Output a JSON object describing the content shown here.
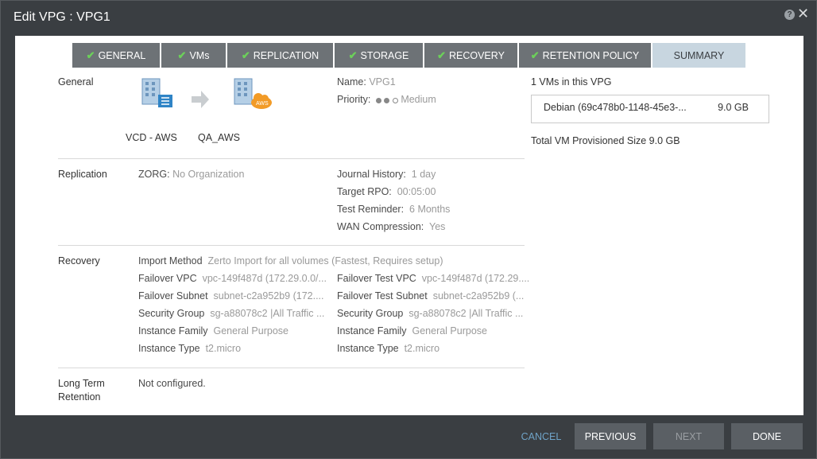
{
  "title": "Edit VPG : VPG1",
  "tabs": [
    {
      "label": "GENERAL",
      "checked": true
    },
    {
      "label": "VMs",
      "checked": true
    },
    {
      "label": "REPLICATION",
      "checked": true
    },
    {
      "label": "STORAGE",
      "checked": true
    },
    {
      "label": "RECOVERY",
      "checked": true
    },
    {
      "label": "RETENTION POLICY",
      "checked": true
    },
    {
      "label": "SUMMARY",
      "checked": false
    }
  ],
  "general": {
    "section_label": "General",
    "source_site": "VCD - AWS",
    "target_site": "QA_AWS",
    "cloud_badge": "AWS",
    "name_key": "Name:",
    "name_value": "VPG1",
    "priority_key": "Priority:",
    "priority_value": "Medium"
  },
  "replication": {
    "section_label": "Replication",
    "zorg_key": "ZORG:",
    "zorg_value": "No Organization",
    "journal_key": "Journal History:",
    "journal_value": "1 day",
    "rpo_key": "Target RPO:",
    "rpo_value": "00:05:00",
    "reminder_key": "Test Reminder:",
    "reminder_value": "6 Months",
    "wan_key": "WAN Compression:",
    "wan_value": "Yes"
  },
  "recovery": {
    "section_label": "Recovery",
    "import_key": "Import Method",
    "import_value": "Zerto Import for all volumes (Fastest, Requires setup)",
    "failover_vpc_key": "Failover VPC",
    "failover_vpc_value": "vpc-149f487d (172.29.0.0/...",
    "failover_test_vpc_key": "Failover Test VPC",
    "failover_test_vpc_value": "vpc-149f487d (172.29....",
    "failover_subnet_key": "Failover Subnet",
    "failover_subnet_value": "subnet-c2a952b9 (172....",
    "failover_test_subnet_key": "Failover Test Subnet",
    "failover_test_subnet_value": "subnet-c2a952b9 (...",
    "security_key": "Security Group",
    "security_value": "sg-a88078c2 |All Traffic ...",
    "test_security_key": "Security Group",
    "test_security_value": "sg-a88078c2 |All Traffic ...",
    "family_key": "Instance Family",
    "family_value": "General Purpose",
    "test_family_key": "Instance Family",
    "test_family_value": "General Purpose",
    "type_key": "Instance Type",
    "type_value": "t2.micro",
    "test_type_key": "Instance Type",
    "test_type_value": "t2.micro"
  },
  "retention": {
    "section_label_line1": "Long Term",
    "section_label_line2": "Retention",
    "value": "Not configured."
  },
  "vms": {
    "header": "1 VMs in this VPG",
    "items": [
      {
        "name": "Debian (69c478b0-1148-45e3-...",
        "size": "9.0 GB"
      }
    ],
    "total": "Total VM Provisioned Size 9.0 GB"
  },
  "footer": {
    "cancel": "CANCEL",
    "previous": "PREVIOUS",
    "next": "NEXT",
    "done": "DONE"
  },
  "colors": {
    "accent_check": "#6cd05a",
    "cancel_link": "#6fa3c7",
    "tab_active": "#c8d6e0",
    "aws_orange": "#f29b27"
  }
}
